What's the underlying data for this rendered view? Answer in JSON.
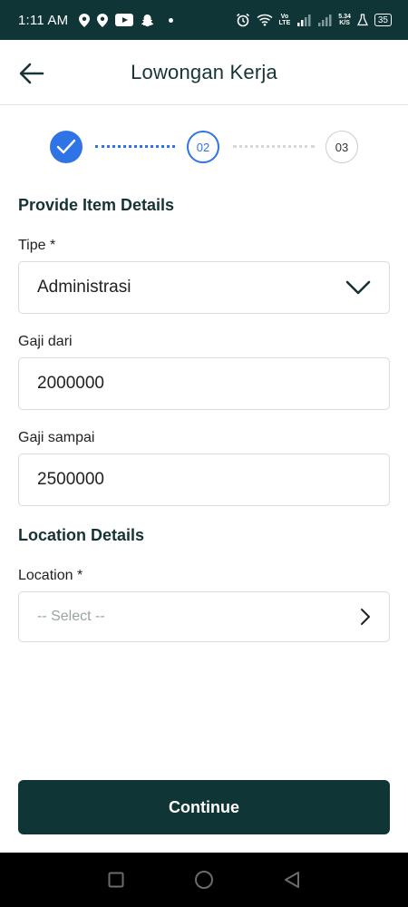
{
  "status_bar": {
    "time": "1:11 AM",
    "net_speed_top": "5.34",
    "net_speed_bottom": "K/S",
    "volte_top": "Vo",
    "volte_bottom": "LTE",
    "battery": "35"
  },
  "header": {
    "title": "Lowongan Kerja"
  },
  "stepper": {
    "step2": "02",
    "step3": "03"
  },
  "form": {
    "section_item": "Provide Item Details",
    "tipe_label": "Tipe *",
    "tipe_value": "Administrasi",
    "gaji_dari_label": "Gaji dari",
    "gaji_dari_value": "2000000",
    "gaji_sampai_label": "Gaji sampai",
    "gaji_sampai_value": "2500000",
    "section_location": "Location Details",
    "location_label": "Location *",
    "location_placeholder": "-- Select --"
  },
  "actions": {
    "continue": "Continue"
  },
  "colors": {
    "primary_dark": "#103536",
    "accent_blue": "#2f74e6"
  }
}
